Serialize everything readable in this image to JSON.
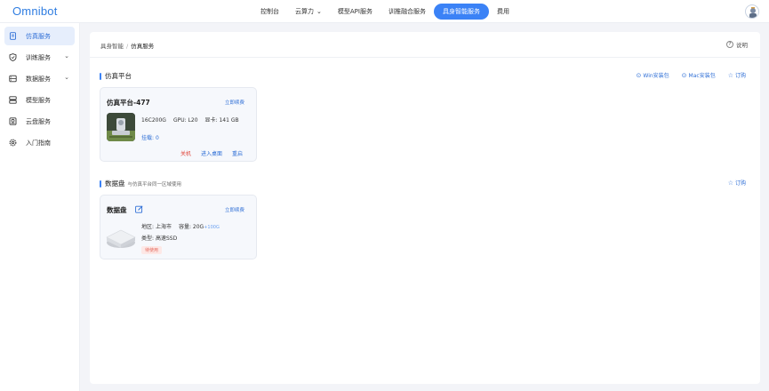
{
  "header": {
    "logo": "Omnibot",
    "nav": [
      {
        "label": "控制台"
      },
      {
        "label": "云算力"
      },
      {
        "label": "模型API服务"
      },
      {
        "label": "训推融合服务"
      },
      {
        "label": "具身智能服务"
      },
      {
        "label": "费用"
      }
    ],
    "active_nav_color": "#3b82f6"
  },
  "sidebar": {
    "items": [
      {
        "label": "仿真服务",
        "icon": "document-icon",
        "active": true
      },
      {
        "label": "训练服务",
        "icon": "shield-icon",
        "expandable": true
      },
      {
        "label": "数据服务",
        "icon": "database-icon",
        "expandable": true
      },
      {
        "label": "模型服务",
        "icon": "server-icon"
      },
      {
        "label": "云盘服务",
        "icon": "disk-icon"
      },
      {
        "label": "入门指南",
        "icon": "gear-icon"
      }
    ]
  },
  "breadcrumb": {
    "root": "具身智能",
    "separator": "/",
    "current": "仿真服务"
  },
  "help": {
    "label": "说明",
    "icon": "question-icon"
  },
  "sim_section": {
    "title": "仿真平台",
    "actions": [
      {
        "label": "Win安装包",
        "icon": "download-icon"
      },
      {
        "label": "Mac安装包",
        "icon": "download-icon"
      },
      {
        "label": "订购",
        "icon": "star-icon"
      }
    ],
    "card": {
      "title": "仿真平台-477",
      "renew": "立即续费",
      "cpu": "16C200G",
      "gpu_label": "GPU:",
      "gpu": "L20",
      "vram_label": "显卡:",
      "vram": "141 GB",
      "mount_label": "挂载:",
      "mount": "0",
      "ops": [
        "关机",
        "进入桌面",
        "重启"
      ]
    }
  },
  "disk_section": {
    "title": "数据盘",
    "subtitle": "与仿真平台同一区域使用",
    "order": "订购",
    "card": {
      "title": "数据盘",
      "renew": "立即续费",
      "region_label": "地区:",
      "region": "上海市",
      "capacity_label": "容量:",
      "capacity": "20G",
      "capacity_extra": "+100G",
      "type_label": "类型:",
      "type": "高速SSD",
      "status": "待使用"
    }
  }
}
